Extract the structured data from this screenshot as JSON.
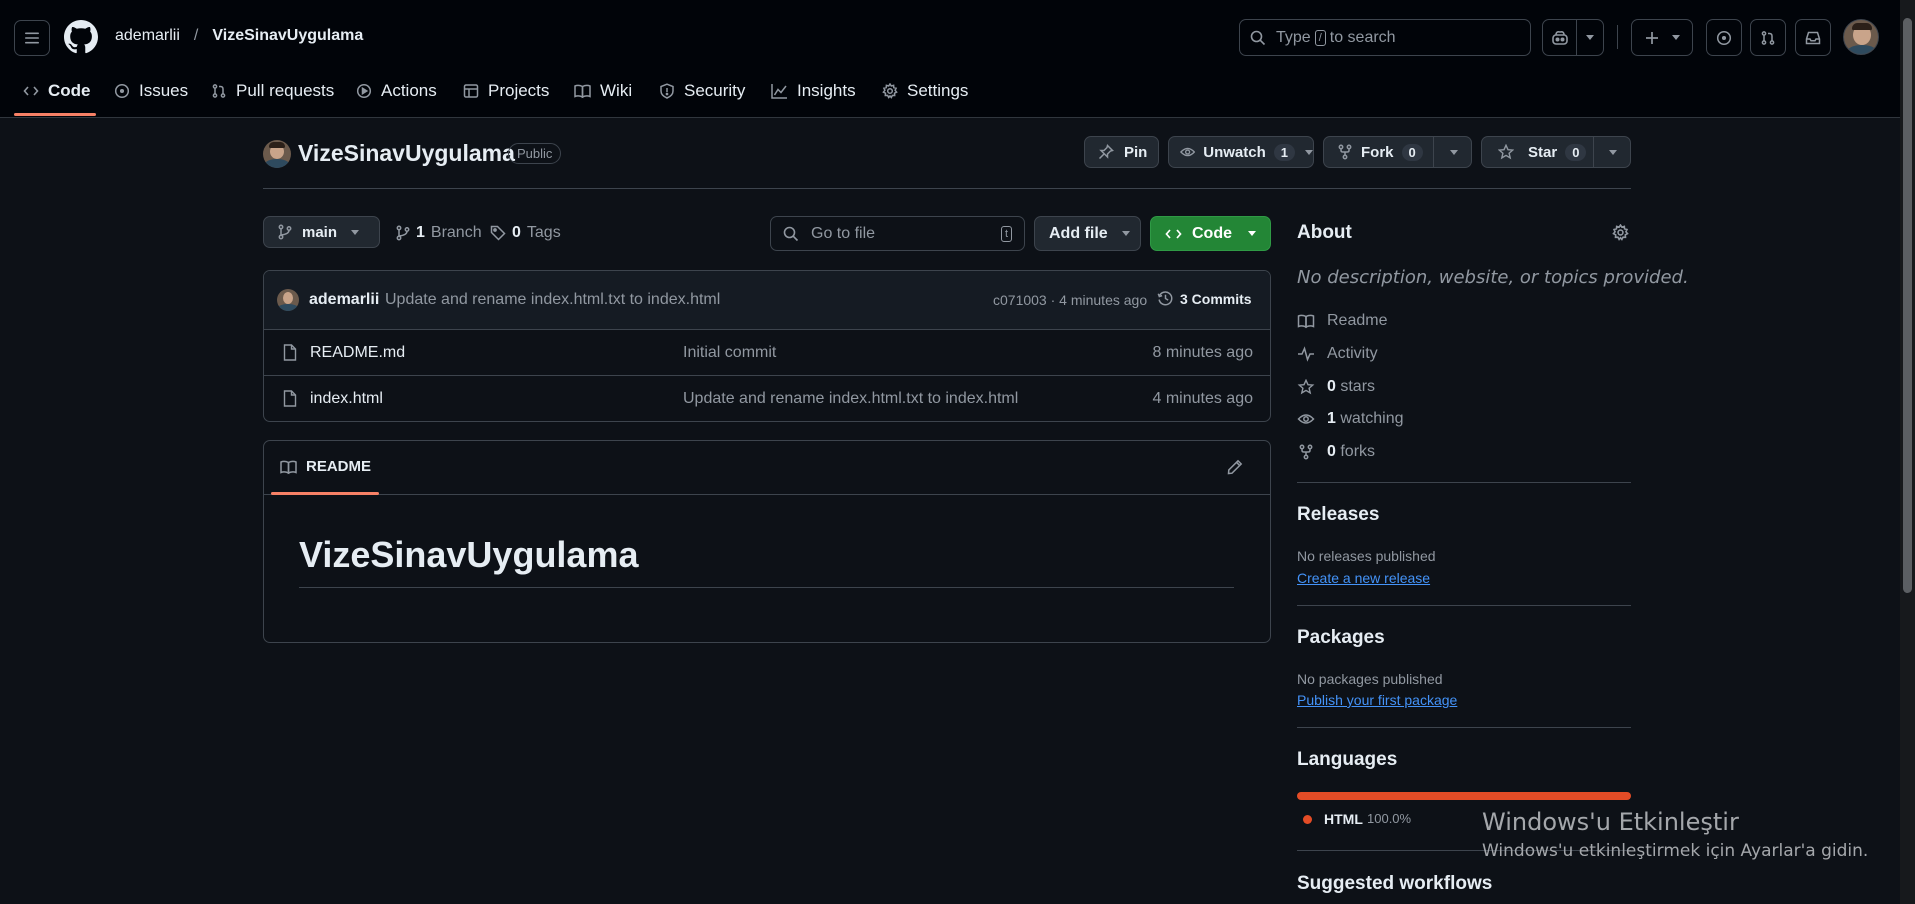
{
  "header": {
    "owner": "ademarlii",
    "separator": "/",
    "repo": "VizeSinavUygulama",
    "search_prefix": "Type",
    "search_key": "/",
    "search_suffix": "to search"
  },
  "tabs": [
    {
      "label": "Code"
    },
    {
      "label": "Issues"
    },
    {
      "label": "Pull requests"
    },
    {
      "label": "Actions"
    },
    {
      "label": "Projects"
    },
    {
      "label": "Wiki"
    },
    {
      "label": "Security"
    },
    {
      "label": "Insights"
    },
    {
      "label": "Settings"
    }
  ],
  "repo_head": {
    "name": "VizeSinavUygulama",
    "visibility": "Public",
    "pin": "Pin",
    "unwatch": "Unwatch",
    "watch_count": "1",
    "fork": "Fork",
    "fork_count": "0",
    "star": "Star",
    "star_count": "0"
  },
  "toolbar": {
    "branch": "main",
    "branch_count": "1",
    "branch_label": "Branch",
    "tag_count": "0",
    "tag_label": "Tags",
    "go_to_file": "Go to file",
    "go_key": "t",
    "add_file": "Add file",
    "code": "Code"
  },
  "commit": {
    "author": "ademarlii",
    "message": "Update and rename index.html.txt to index.html",
    "meta": "c071003 · 4 minutes ago",
    "count": "3 Commits"
  },
  "files": [
    {
      "name": "README.md",
      "message": "Initial commit",
      "time": "8 minutes ago"
    },
    {
      "name": "index.html",
      "message": "Update and rename index.html.txt to index.html",
      "time": "4 minutes ago"
    }
  ],
  "readme": {
    "tab": "README",
    "heading": "VizeSinavUygulama"
  },
  "about": {
    "title": "About",
    "description": "No description, website, or topics provided.",
    "readme": "Readme",
    "activity": "Activity",
    "stars_count": "0",
    "stars_label": "stars",
    "watching_count": "1",
    "watching_label": "watching",
    "forks_count": "0",
    "forks_label": "forks"
  },
  "releases": {
    "title": "Releases",
    "note": "No releases published",
    "link": "Create a new release"
  },
  "packages": {
    "title": "Packages",
    "note": "No packages published",
    "link": "Publish your first package"
  },
  "languages": {
    "title": "Languages",
    "name": "HTML",
    "percent": "100.0%",
    "share": 100,
    "color": "#e34c26"
  },
  "suggested": {
    "title": "Suggested workflows"
  },
  "watermark": {
    "title": "Windows'u Etkinleştir",
    "subtitle": "Windows'u etkinleştirmek için Ayarlar'a gidin."
  },
  "colors": {
    "background": "#0d1117",
    "accent_tab": "#f78166",
    "primary_button": "#238636",
    "link": "#4493f8"
  }
}
